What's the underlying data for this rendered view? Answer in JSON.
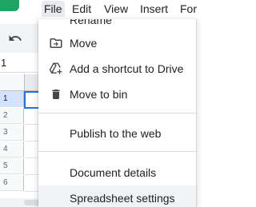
{
  "menubar": {
    "items": [
      {
        "label": "File",
        "active": true
      },
      {
        "label": "Edit"
      },
      {
        "label": "View"
      },
      {
        "label": "Insert"
      },
      {
        "label": "For"
      }
    ]
  },
  "namebox": {
    "value": "1"
  },
  "grid": {
    "row_numbers": [
      "1",
      "2",
      "3",
      "4",
      "5",
      "6"
    ],
    "selected_row": "1"
  },
  "file_menu": {
    "items": [
      {
        "label": "Rename",
        "icon": "rename-icon"
      },
      {
        "label": "Move",
        "icon": "move-folder-icon"
      },
      {
        "label": "Add a shortcut to Drive",
        "icon": "add-shortcut-icon"
      },
      {
        "label": "Move to bin",
        "icon": "trash-icon"
      },
      {
        "label": "Publish to the web"
      },
      {
        "label": "Document details"
      },
      {
        "label": "Spreadsheet settings"
      }
    ]
  },
  "colors": {
    "brand": "#1fa463",
    "selection": "#1a73e8",
    "menu_highlight": "#f1f3f4",
    "icon": "#444746"
  }
}
